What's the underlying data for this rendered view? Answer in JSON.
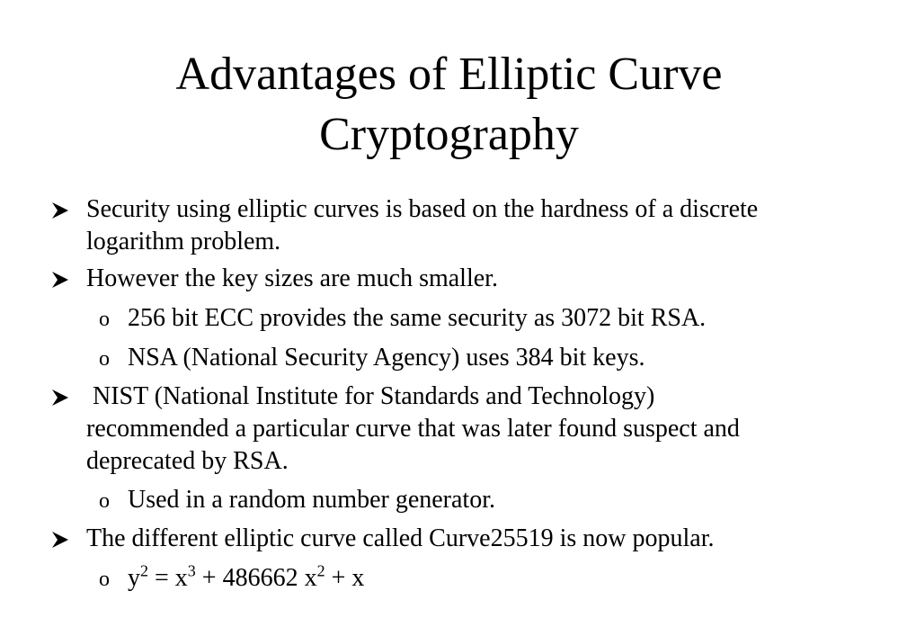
{
  "title": {
    "line1": "Advantages of Elliptic Curve",
    "line2": "Cryptography"
  },
  "bullets": [
    {
      "lines": [
        "Security using elliptic curves is based on the hardness of a discrete",
        "logarithm problem."
      ]
    },
    {
      "lines": [
        "However the key sizes are much smaller."
      ],
      "subs": [
        "256 bit ECC provides the same security as 3072 bit RSA.",
        "NSA (National Security Agency) uses 384 bit keys."
      ]
    },
    {
      "lines": [
        " NIST (National Institute for Standards and Technology)",
        "recommended a particular curve that was later found suspect and",
        "deprecated by RSA."
      ],
      "subs": [
        "Used in a random number generator."
      ]
    },
    {
      "lines": [
        "The different elliptic curve called Curve25519 is now popular."
      ],
      "subs_rich": {
        "y": "y",
        "exp2a": "2",
        "eq_x": " = x",
        "exp3": "3",
        "plus_coef": " + 486662 x",
        "exp2b": "2",
        "tail": " + x"
      }
    }
  ],
  "markers": {
    "bullet_icon": "arrowhead-bullet-icon",
    "sub_bullet_glyph": "o"
  }
}
